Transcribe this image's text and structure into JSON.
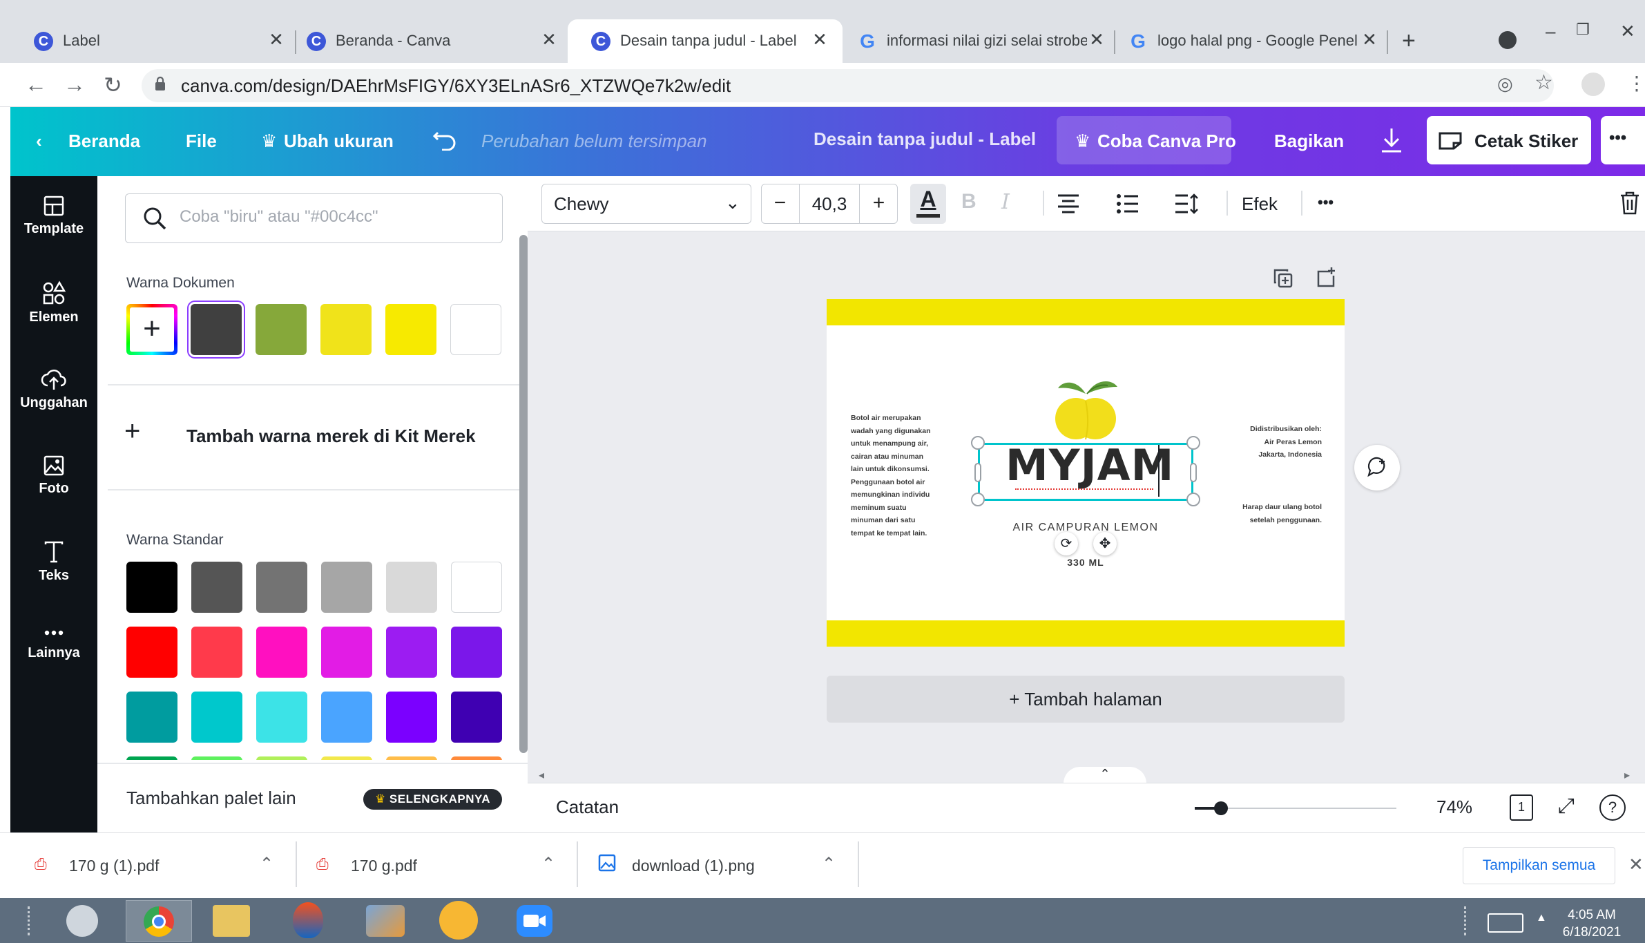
{
  "browser": {
    "tabs": [
      {
        "title": "Label",
        "icon": "canva-icon"
      },
      {
        "title": "Beranda - Canva",
        "icon": "canva-icon"
      },
      {
        "title": "Desain tanpa judul - Label",
        "icon": "canva-icon",
        "active": true
      },
      {
        "title": "informasi nilai gizi selai strober",
        "icon": "google-icon"
      },
      {
        "title": "logo halal png - Google Penel",
        "icon": "google-icon"
      }
    ],
    "new_tab": "+",
    "url": "canva.com/design/DAEhrMsFIGY/6XY3ELnASr6_XTZWQe7k2w/edit"
  },
  "canva_header": {
    "home": "Beranda",
    "file": "File",
    "resize": "Ubah ukuran",
    "unsaved": "Perubahan belum tersimpan",
    "doc_title": "Desain tanpa judul - Label",
    "try_pro": "Coba Canva Pro",
    "share": "Bagikan",
    "print": "Cetak Stiker",
    "more": "•••"
  },
  "rail": {
    "items": [
      "Template",
      "Elemen",
      "Unggahan",
      "Foto",
      "Teks",
      "Lainnya"
    ]
  },
  "color_panel": {
    "search_placeholder": "Coba \"biru\" atau \"#00c4cc\"",
    "document_colors_heading": "Warna Dokumen",
    "document_colors": [
      "#404040",
      "#86a83a",
      "#f0e31a",
      "#f7ea00",
      "#ffffff"
    ],
    "add_brand": "Tambah warna merek di Kit Merek",
    "standard_heading": "Warna Standar",
    "standard_colors": [
      "#000000",
      "#555555",
      "#737373",
      "#a6a6a6",
      "#d9d9d9",
      "#ffffff",
      "#ff0000",
      "#ff3a4b",
      "#ff10c0",
      "#e21ce5",
      "#9c1cf2",
      "#7b17ea",
      "#009c9f",
      "#00c8cc",
      "#3ce3e7",
      "#4aa4ff",
      "#7b00ff",
      "#3f00b2",
      "#00a550",
      "#5ef15e",
      "#b0f05a",
      "#f2e84b",
      "#ffbd4a",
      "#ff8a3a"
    ],
    "more_palettes": "Tambahkan palet lain",
    "see_more": "SELENGKAPNYA"
  },
  "toolbar": {
    "font": "Chewy",
    "minus": "−",
    "size": "40,3",
    "plus": "+",
    "bold": "B",
    "italic": "I",
    "effects": "Efek",
    "more": "•••"
  },
  "design": {
    "left_text": [
      "Botol air merupakan",
      "wadah yang digunakan",
      "untuk menampung air,",
      "cairan atau minuman",
      "lain untuk dikonsumsi.",
      "Penggunaan botol air",
      "memungkinan individu",
      "meminum suatu",
      "minuman dari satu",
      "tempat ke tempat lain."
    ],
    "right_text": [
      "Didistribusikan oleh:",
      "Air Peras Lemon",
      "Jakarta, Indonesia"
    ],
    "recycle_text": [
      "Harap daur ulang botol",
      "setelah penggunaan."
    ],
    "brand": "MYJAM",
    "subtitle": "AIR CAMPURAN LEMON",
    "volume": "330 ML",
    "brand_colors": {
      "band": "#f2e600",
      "lemon": "#f2de1b",
      "leaf": "#5f9d3a"
    }
  },
  "editor": {
    "add_page": "+ Tambah halaman",
    "notes": "Catatan",
    "zoom": "74%",
    "page_count": "1"
  },
  "downloads": {
    "items": [
      "170 g (1).pdf",
      "170 g.pdf",
      "download (1).png"
    ],
    "show_all": "Tampilkan semua"
  },
  "taskbar": {
    "time": "4:05 AM",
    "date": "6/18/2021"
  },
  "accent": {
    "canva_cyan": "#00c4cc",
    "canva_purple": "#7d2ae8",
    "selection": "#00c4cc"
  }
}
